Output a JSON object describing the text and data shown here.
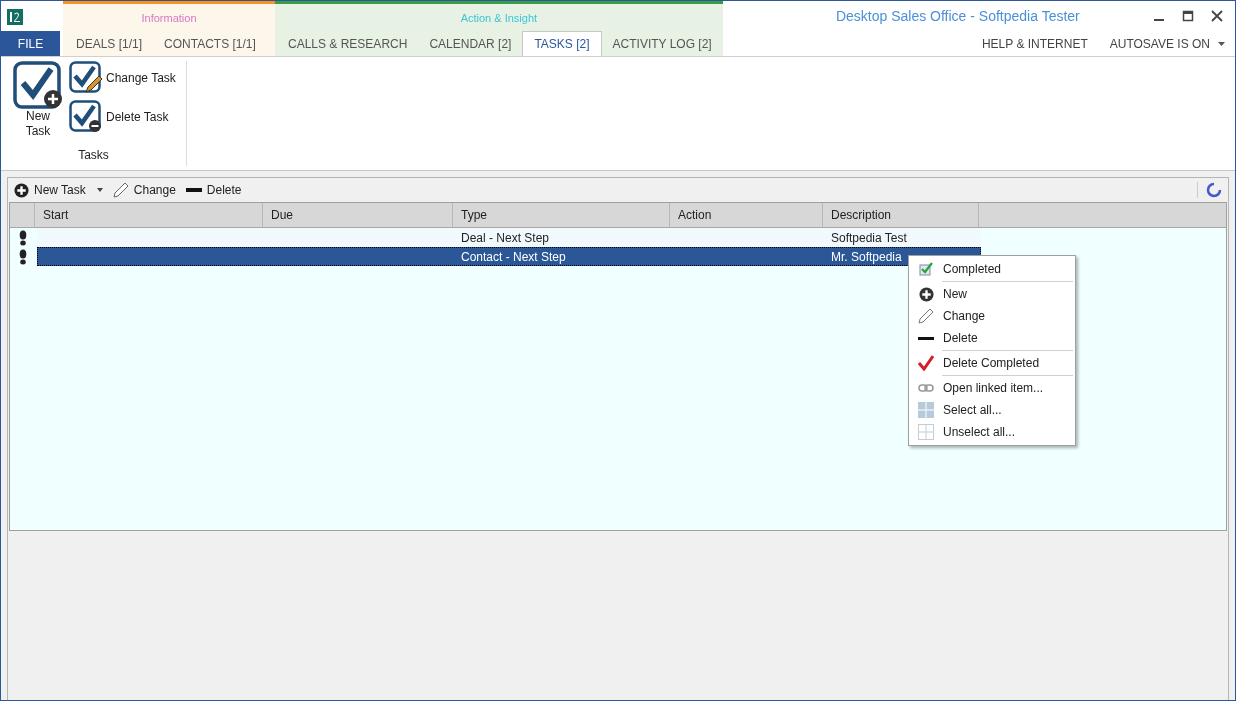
{
  "window": {
    "title": "Desktop Sales Office - Softpedia Tester"
  },
  "file_tab": "FILE",
  "tab_groups": [
    {
      "label": "Information",
      "kind": "info",
      "tabs": [
        {
          "label": "DEALS [1/1]",
          "selected": false
        },
        {
          "label": "CONTACTS [1/1]",
          "selected": false
        }
      ]
    },
    {
      "label": "Action & Insight",
      "kind": "action",
      "tabs": [
        {
          "label": "CALLS & RESEARCH",
          "selected": false
        },
        {
          "label": "CALENDAR [2]",
          "selected": false
        },
        {
          "label": "TASKS [2]",
          "selected": true
        },
        {
          "label": "ACTIVITY LOG [2]",
          "selected": false
        }
      ]
    }
  ],
  "right_links": [
    {
      "label": "HELP & INTERNET",
      "dropdown": false
    },
    {
      "label": "AUTOSAVE IS ON",
      "dropdown": true
    }
  ],
  "ribbon": {
    "group_label": "Tasks",
    "big_button": "New Task",
    "small_buttons": [
      {
        "label": "Change Task",
        "kind": "change"
      },
      {
        "label": "Delete Task",
        "kind": "delete"
      }
    ]
  },
  "toolbar": [
    {
      "label": "New Task",
      "kind": "new",
      "dropdown": true
    },
    {
      "label": "Change",
      "kind": "change",
      "dropdown": false
    },
    {
      "label": "Delete",
      "kind": "delete",
      "dropdown": false
    }
  ],
  "table": {
    "columns": [
      "Start",
      "Due",
      "Type",
      "Action",
      "Description"
    ],
    "rows": [
      {
        "cells": [
          "",
          "",
          "Deal - Next Step",
          "",
          "Softpedia Test"
        ],
        "selected": false
      },
      {
        "cells": [
          "",
          "",
          "Contact - Next Step",
          "",
          "Mr. Softpedia"
        ],
        "selected": true
      }
    ]
  },
  "context_menu": [
    {
      "label": "Completed",
      "kind": "check",
      "separator_before": false
    },
    {
      "label": "New",
      "kind": "plus",
      "separator_before": true
    },
    {
      "label": "Change",
      "kind": "pencil",
      "separator_before": false
    },
    {
      "label": "Delete",
      "kind": "minus",
      "separator_before": false
    },
    {
      "label": "Delete Completed",
      "kind": "redcheck",
      "separator_before": true
    },
    {
      "label": "Open linked item...",
      "kind": "link",
      "separator_before": true
    },
    {
      "label": "Select all...",
      "kind": "gridfill",
      "separator_before": false
    },
    {
      "label": "Unselect all...",
      "kind": "gridempty",
      "separator_before": false
    }
  ]
}
